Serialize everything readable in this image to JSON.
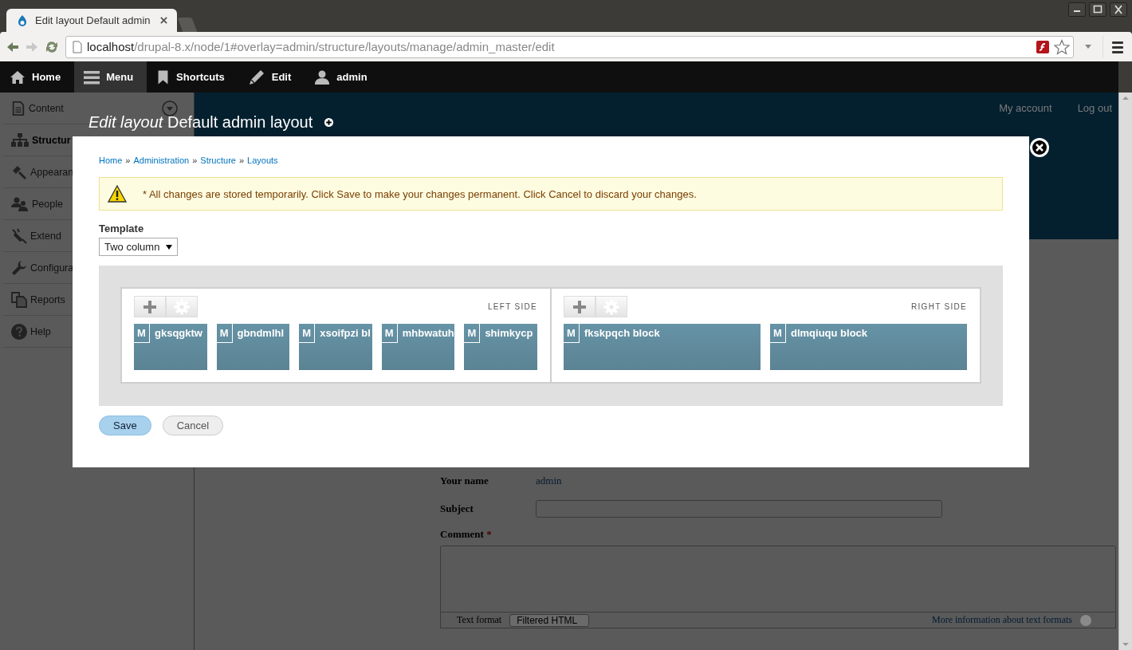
{
  "browser": {
    "tabs": [
      {
        "title": "Edit layout Default admin",
        "selected": true
      },
      {
        "selected": false
      }
    ],
    "url_host": "localhost",
    "url_path": "/drupal-8.x/node/1#overlay=admin/structure/layouts/manage/admin_master/edit"
  },
  "toolbar": {
    "items": [
      {
        "label": "Home",
        "selected": false
      },
      {
        "label": "Menu",
        "selected": true
      },
      {
        "label": "Shortcuts",
        "selected": false
      },
      {
        "label": "Edit",
        "selected": false
      },
      {
        "label": "admin",
        "selected": false
      }
    ]
  },
  "sidebar": {
    "items": [
      {
        "label": "Content",
        "selected": false,
        "expandable": true
      },
      {
        "label": "Structur",
        "selected": true,
        "expandable": false
      },
      {
        "label": "Appearan",
        "selected": false,
        "expandable": false
      },
      {
        "label": "People",
        "selected": false,
        "expandable": false
      },
      {
        "label": "Extend",
        "selected": false,
        "expandable": false
      },
      {
        "label": "Configura",
        "selected": false,
        "expandable": false
      },
      {
        "label": "Reports",
        "selected": false,
        "expandable": false
      },
      {
        "label": "Help",
        "selected": false,
        "expandable": false
      }
    ]
  },
  "header": {
    "links": [
      "My account",
      "Log out"
    ],
    "title_prefix": "Edit layout",
    "title": "Default admin layout"
  },
  "comment_form": {
    "name_label": "Your name",
    "name_value": "admin",
    "subject_label": "Subject",
    "comment_label": "Comment",
    "required_mark": "*",
    "format_label": "Text format",
    "format_value": "Filtered HTML",
    "format_help": "More information about text formats"
  },
  "dialog": {
    "breadcrumb": [
      "Home",
      "Administration",
      "Structure",
      "Layouts"
    ],
    "breadcrumb_separator": "»",
    "message": "* All changes are stored temporarily. Click Save to make your changes permanent. Click Cancel to discard your changes.",
    "template_label": "Template",
    "template_value": "Two column",
    "regions": [
      {
        "label": "LEFT SIDE",
        "blocks": [
          {
            "badge": "M",
            "name": "gksqgktw"
          },
          {
            "badge": "M",
            "name": "gbndmlhl"
          },
          {
            "badge": "M",
            "name": "xsoifpzi bl"
          },
          {
            "badge": "M",
            "name": "mhbwatuh"
          },
          {
            "badge": "M",
            "name": "shimkycp"
          }
        ]
      },
      {
        "label": "RIGHT SIDE",
        "blocks": [
          {
            "badge": "M",
            "name": "fkskpqch block"
          },
          {
            "badge": "M",
            "name": "dlmqiuqu block"
          }
        ]
      }
    ],
    "buttons": [
      {
        "label": "Save",
        "kind": "primary"
      },
      {
        "label": "Cancel",
        "kind": "secondary"
      }
    ]
  }
}
